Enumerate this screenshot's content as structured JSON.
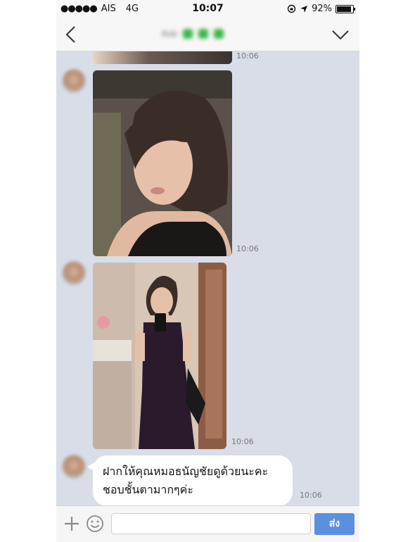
{
  "status_bar": {
    "carrier": "AIS",
    "network": "4G",
    "time": "10:07",
    "battery": "92%",
    "battery_level": 0.92
  },
  "header": {
    "contact_name": "Kob",
    "back_icon": "chevron-left-icon",
    "menu_icon": "chevron-down-icon"
  },
  "messages": [
    {
      "type": "image",
      "time": "10:06"
    },
    {
      "type": "image",
      "time": "10:06"
    },
    {
      "type": "image",
      "time": "10:06"
    },
    {
      "type": "text",
      "line1": "ฝากให้คุณหมอธนัญชัยดูด้วยนะคะ",
      "line2": "ชอบชั้นตามากๆค่ะ",
      "time": "10:06"
    }
  ],
  "input_bar": {
    "placeholder": "",
    "send_label": "ส่ง",
    "plus_icon": "plus-icon",
    "emoji_icon": "smiley-icon"
  },
  "colors": {
    "chat_bg": "#d8dde8",
    "send_button": "#5b8fe0",
    "header_bg": "#f7f7f7"
  }
}
